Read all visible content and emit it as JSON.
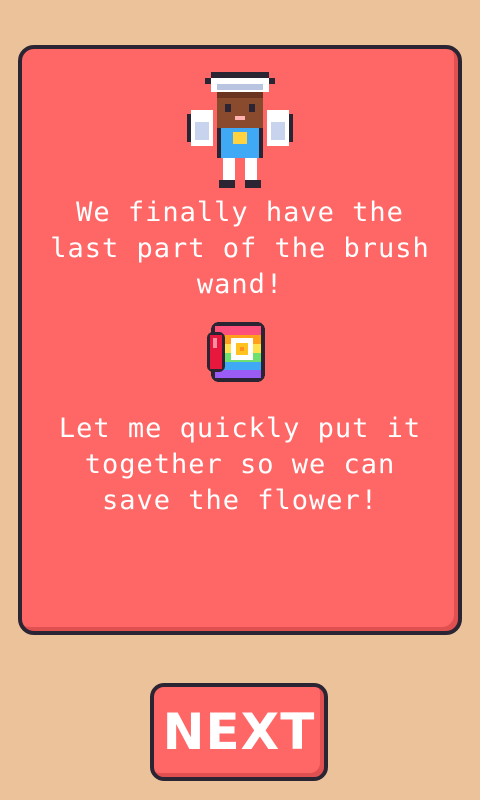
{
  "dialog": {
    "line1": "We finally have the\nlast part of the brush\nwand!",
    "line2": "Let me quickly put it\ntogether so we can\nsave the flower!",
    "character_icon": "character-portrait-icon",
    "item_icon": "brush-wand-part-icon"
  },
  "next_button": {
    "label": "NEXT"
  },
  "colors": {
    "background": "#ecc29a",
    "panel": "#ff6666",
    "outline": "#2a2433",
    "text": "#ffffff"
  }
}
